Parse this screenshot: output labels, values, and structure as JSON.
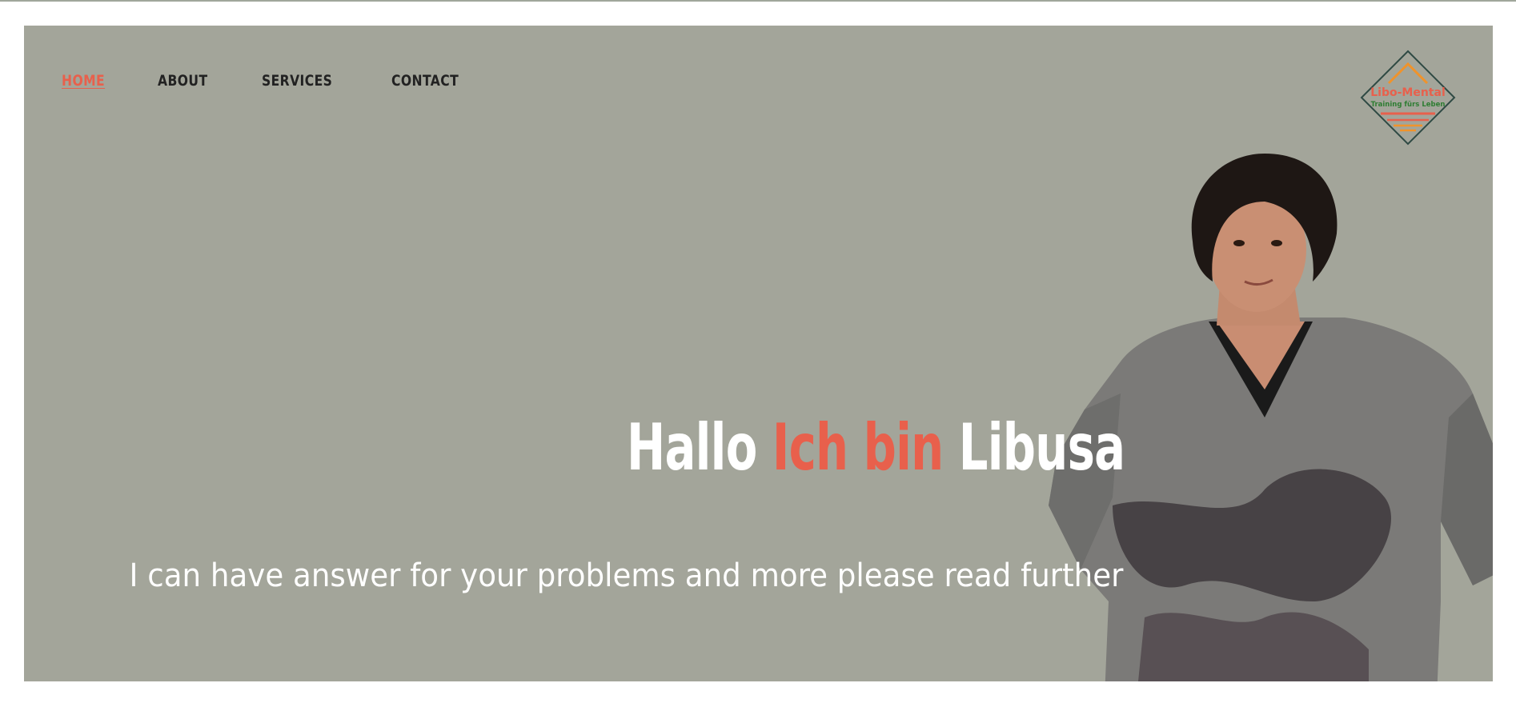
{
  "nav": {
    "items": [
      {
        "label": "HOME",
        "active": true
      },
      {
        "label": "ABOUT",
        "active": false
      },
      {
        "label": "SERVICES",
        "active": false
      },
      {
        "label": "CONTACT",
        "active": false
      }
    ]
  },
  "logo": {
    "title": "Libo-Mental",
    "tagline": "Training fürs Leben"
  },
  "hero": {
    "headline_part1": "Hallo ",
    "headline_part2": "Ich bin",
    "headline_part3": " Libusa",
    "subline": "I can have answer for your problems and more please read further"
  },
  "colors": {
    "hero_background": "#a3a59a",
    "accent": "#e8604c",
    "nav_text": "#222222",
    "logo_green": "#2e7d32",
    "logo_orange": "#f0932b"
  }
}
